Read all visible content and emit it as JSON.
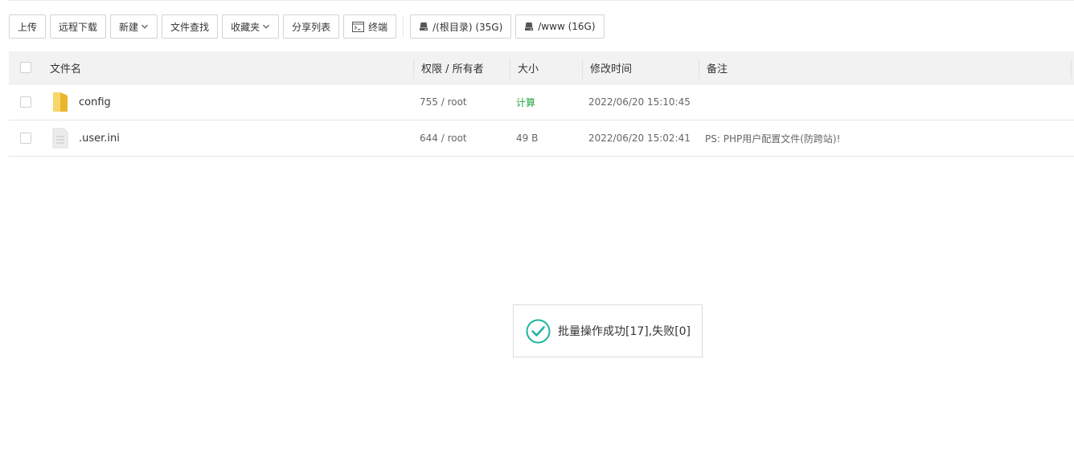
{
  "toolbar": {
    "upload": "上传",
    "remote_download": "远程下载",
    "new": "新建",
    "file_search": "文件查找",
    "favorites": "收藏夹",
    "share_list": "分享列表",
    "terminal": "终端",
    "disk_root": "/(根目录) (35G)",
    "disk_www": "/www (16G)"
  },
  "table": {
    "headers": {
      "filename": "文件名",
      "permission_owner": "权限 / 所有者",
      "size": "大小",
      "modified": "修改时间",
      "remark": "备注"
    },
    "rows": [
      {
        "name": "config",
        "type": "folder",
        "perm": "755 / root",
        "size": "计算",
        "modified": "2022/06/20 15:10:45",
        "remark": ""
      },
      {
        "name": ".user.ini",
        "type": "file",
        "perm": "644 / root",
        "size": "49 B",
        "modified": "2022/06/20 15:02:41",
        "remark": "PS: PHP用户配置文件(防跨站)!"
      }
    ]
  },
  "toast": {
    "message": "批量操作成功[17],失败[0]"
  },
  "colors": {
    "accent": "#20a53a",
    "success_icon": "#1cb4a0"
  }
}
